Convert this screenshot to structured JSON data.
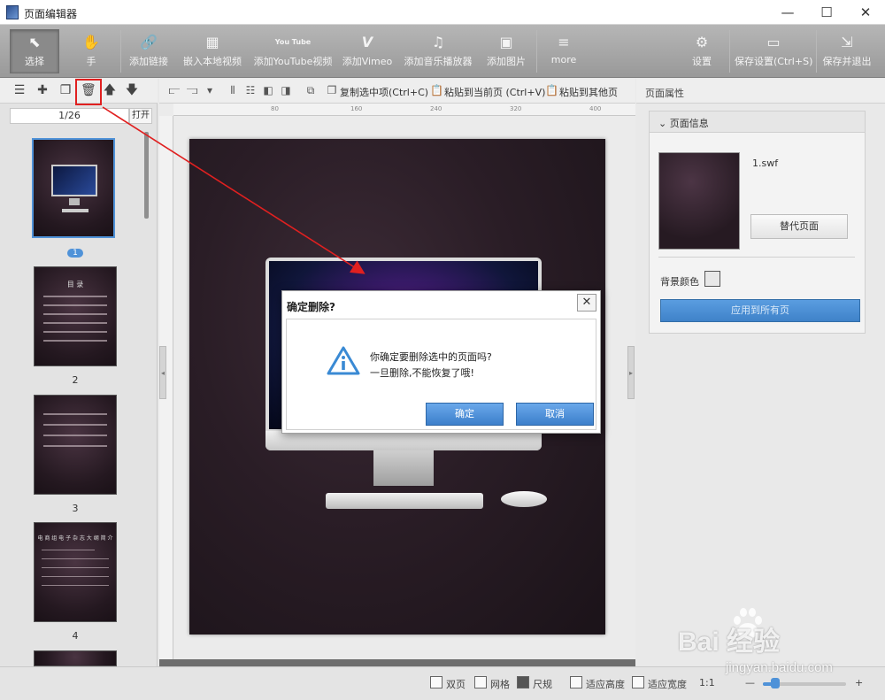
{
  "window": {
    "title": "页面编辑器",
    "minimize": "—",
    "maximize": "☐",
    "close": "✕"
  },
  "toolbar": {
    "items": [
      {
        "label": "选择",
        "icon": "cursor-icon"
      },
      {
        "label": "手",
        "icon": "hand-icon"
      },
      {
        "label": "添加链接",
        "icon": "link-icon"
      },
      {
        "label": "嵌入本地视频",
        "icon": "film-icon"
      },
      {
        "label": "添加YouTube视频",
        "icon": "youtube-icon"
      },
      {
        "label": "添加Vimeo",
        "icon": "vimeo-icon"
      },
      {
        "label": "添加音乐播放器",
        "icon": "music-icon"
      },
      {
        "label": "添加图片",
        "icon": "image-icon"
      },
      {
        "label": "more",
        "icon": "more-icon"
      },
      {
        "label": "设置",
        "icon": "gear-icon"
      },
      {
        "label": "保存设置(Ctrl+S)",
        "icon": "save-icon"
      },
      {
        "label": "保存并退出",
        "icon": "exit-icon"
      }
    ],
    "icons": {
      "youtube": "You Tube",
      "vimeo": "V",
      "music": "♫",
      "more": "≡"
    }
  },
  "left_panel": {
    "page_counter": "1/26",
    "open_label": "打开",
    "thumbs": [
      {
        "num": "1",
        "selected": true
      },
      {
        "num": "2",
        "title": "目 录"
      },
      {
        "num": "3"
      },
      {
        "num": "4",
        "title": "电 商 组 电 子 杂 志 大 纲 简 介"
      }
    ]
  },
  "center_toolbar": {
    "copy_label": "复制选中项(Ctrl+C)",
    "paste_label": "粘贴到当前页 (Ctrl+V)",
    "paste_other_label": "粘贴到其他页"
  },
  "ruler": {
    "h": [
      "80",
      "160",
      "240",
      "320",
      "400"
    ],
    "v": [
      "8",
      "0",
      "1",
      "6",
      "0",
      "2",
      "4",
      "0",
      "3",
      "2",
      "0",
      "4",
      "0",
      "0",
      "4",
      "8",
      "0",
      "5",
      "6",
      "0"
    ]
  },
  "right_panel": {
    "header": "页面属性",
    "section_title": "页面信息",
    "file_name": "1.swf",
    "replace_button": "替代页面",
    "bg_color_label": "背景颜色",
    "apply_button": "应用到所有页"
  },
  "statusbar": {
    "double_page": "双页",
    "grid": "网格",
    "ruler": "尺规",
    "fit_height": "适应高度",
    "fit_width": "适应宽度",
    "zoom_text": "1:1",
    "zoom_minus": "—",
    "zoom_plus": "+",
    "zoom_level": 0.15
  },
  "dialog": {
    "title": "确定删除?",
    "message_line1": "你确定要删除选中的页面吗?",
    "message_line2": "一旦删除,不能恢复了哦!",
    "ok_button": "确定",
    "cancel_button": "取消",
    "close": "✕"
  },
  "watermark": {
    "text": "Bai 经验",
    "sub": "jingyan.baidu.com"
  },
  "colors": {
    "accent": "#4f92d8",
    "annotation": "#e02020",
    "toolbar": "#a8a8a8"
  }
}
